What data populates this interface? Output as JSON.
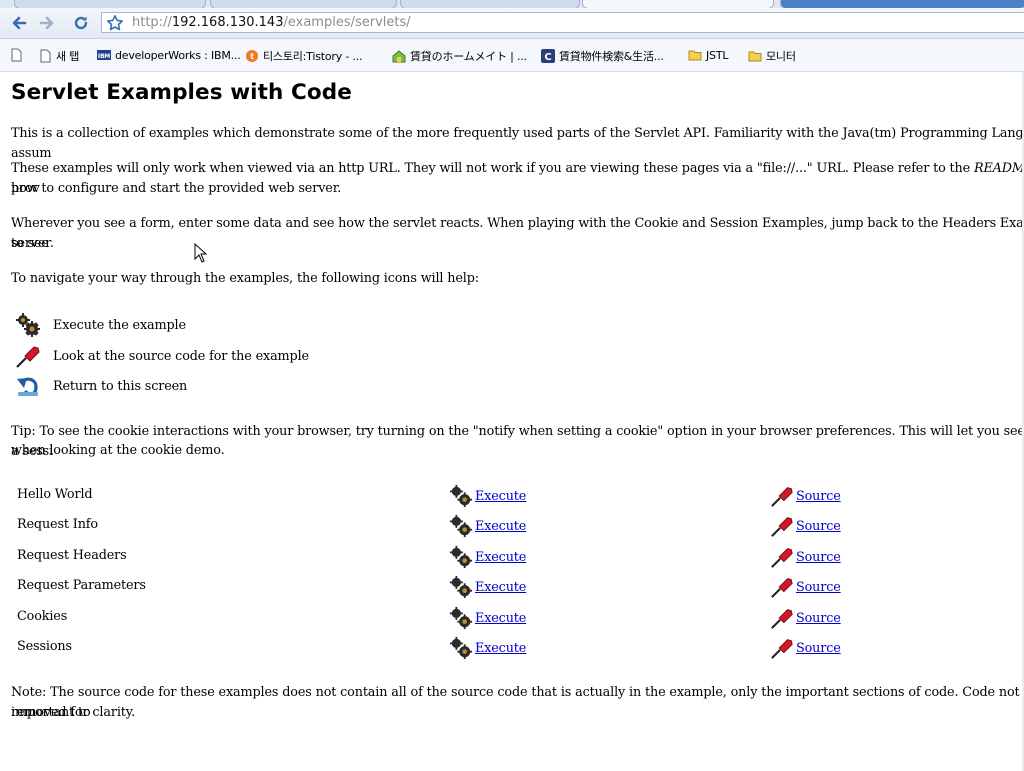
{
  "browser": {
    "url_prefix": "http://",
    "url_host": "192.168.130.143",
    "url_path": "/examples/servlets/",
    "bookmarks": [
      {
        "label": "",
        "icon": "page-icon"
      },
      {
        "label": "새 탭",
        "icon": "page-icon"
      },
      {
        "label": "developerWorks : IBM...",
        "icon": "ibm-icon"
      },
      {
        "label": "티스토리:Tistory - ...",
        "icon": "tistory-icon"
      },
      {
        "label": "賃貸のホームメイト | ...",
        "icon": "house-icon"
      },
      {
        "label": "賃貸物件検索&生活...",
        "icon": "c-icon"
      },
      {
        "label": "JSTL",
        "icon": "folder-icon"
      },
      {
        "label": "모니터",
        "icon": "folder-icon"
      }
    ]
  },
  "page": {
    "title": "Servlet Examples with Code",
    "intro": "This is a collection of examples which demonstrate some of the more frequently used parts of the Servlet API. Familiarity with the Java(tm) Programming Language is assum",
    "http_note_a": "These examples will only work when viewed via an http URL. They will not work if you are viewing these pages via a \"file://...\" URL. Please refer to the ",
    "http_note_readme": "README",
    "http_note_b": " file prov",
    "http_note_line2": "how to configure and start the provided web server.",
    "form_note_line1": "Wherever you see a form, enter some data and see how the servlet reacts. When playing with the Cookie and Session Examples, jump back to the Headers Example to see",
    "form_note_line2": "server.",
    "navigate_note": "To navigate your way through the examples, the following icons will help:",
    "legend": {
      "execute": "Execute the example",
      "source": "Look at the source code for the example",
      "return": "Return to this screen"
    },
    "tip_line1": "Tip: To see the cookie interactions with your browser, try turning on the \"notify when setting a cookie\" option in your browser preferences. This will let you see when a sessi",
    "tip_line2": "when looking at the cookie demo.",
    "examples": [
      {
        "name": "Hello World",
        "execute": "Execute",
        "source": "Source"
      },
      {
        "name": "Request Info",
        "execute": "Execute",
        "source": "Source"
      },
      {
        "name": "Request Headers",
        "execute": "Execute",
        "source": "Source"
      },
      {
        "name": "Request Parameters",
        "execute": "Execute",
        "source": "Source"
      },
      {
        "name": "Cookies",
        "execute": "Execute",
        "source": "Source"
      },
      {
        "name": "Sessions",
        "execute": "Execute",
        "source": "Source"
      }
    ],
    "footer_line1": "Note: The source code for these examples does not contain all of the source code that is actually in the example, only the important sections of code. Code not important to",
    "footer_line2": "removed for clarity."
  },
  "colors": {
    "link": "#0000cc",
    "nav_arrow": "#3b6db3",
    "execute_gear": "#2b2b2b",
    "source_handle": "#d4162a",
    "return_arrow": "#1f5fa8"
  }
}
